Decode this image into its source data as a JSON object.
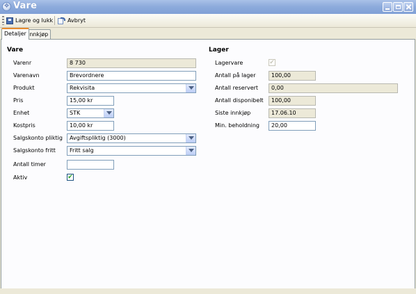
{
  "window": {
    "title": "Vare",
    "icon": "app-icon"
  },
  "toolbar": {
    "save_label": "Lagre og lukk",
    "cancel_label": "Avbryt"
  },
  "tabs": [
    {
      "label": "Detaljer",
      "active": true
    },
    {
      "label": "Innkjøp",
      "active": false
    }
  ],
  "vare": {
    "title": "Vare",
    "varenr": {
      "label": "Varenr",
      "value": "8 730"
    },
    "varenavn": {
      "label": "Varenavn",
      "value": "Brevordnere"
    },
    "produkt": {
      "label": "Produkt",
      "value": "Rekvisita"
    },
    "pris": {
      "label": "Pris",
      "value": "15,00 kr"
    },
    "enhet": {
      "label": "Enhet",
      "value": "STK"
    },
    "kostpris": {
      "label": "Kostpris",
      "value": "10,00 kr"
    },
    "salgskonto_pliktig": {
      "label": "Salgskonto pliktig",
      "value": "Avgiftspliktig (3000)"
    },
    "salgskonto_fritt": {
      "label": "Salgskonto fritt",
      "value": "Fritt salg"
    },
    "antall_timer": {
      "label": "Antall timer",
      "value": ""
    },
    "aktiv": {
      "label": "Aktiv",
      "checked": true
    }
  },
  "lager": {
    "title": "Lager",
    "lagervare": {
      "label": "Lagervare",
      "checked": true,
      "disabled": true
    },
    "antall_pa_lager": {
      "label": "Antall på lager",
      "value": "100,00"
    },
    "antall_reservert": {
      "label": "Antall reservert",
      "value": "0,00"
    },
    "antall_disponibelt": {
      "label": "Antall disponibelt",
      "value": "100,00"
    },
    "siste_innkjop": {
      "label": "Siste innkjøp",
      "value": "17.06.10"
    },
    "min_beholdning": {
      "label": "Min. beholdning",
      "value": "20,00"
    }
  }
}
